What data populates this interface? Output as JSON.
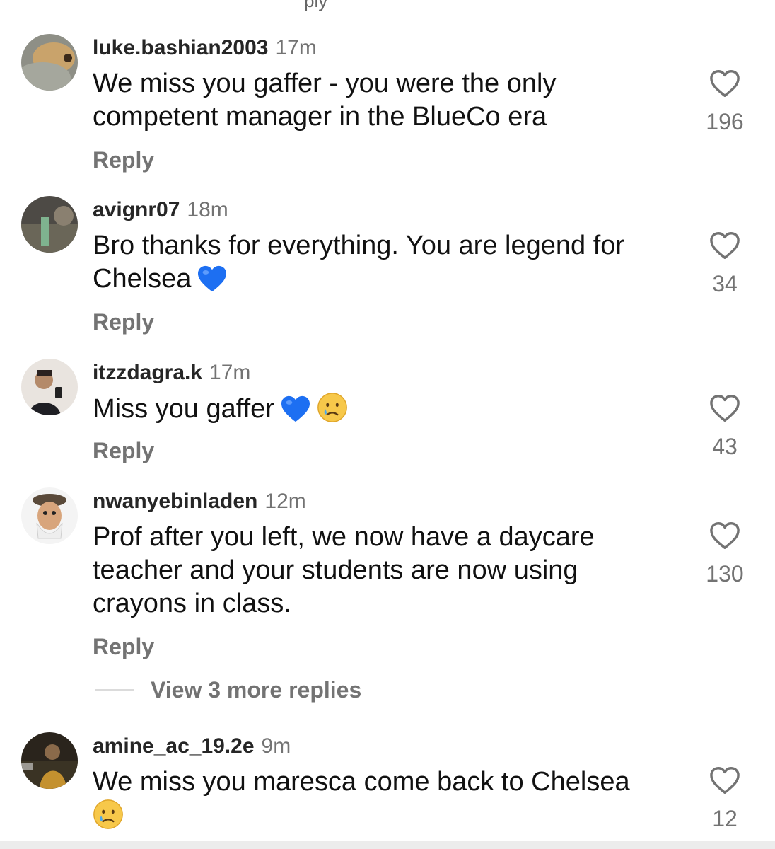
{
  "top_cut_label": "ply",
  "comments": [
    {
      "username": "luke.bashian2003",
      "time": "17m",
      "text": "We miss you gaffer - you were the only competent manager in the BlueCo era",
      "reply": "Reply",
      "likes": "196"
    },
    {
      "username": "avignr07",
      "time": "18m",
      "text": "Bro thanks for everything. You are legend for Chelsea",
      "reply": "Reply",
      "likes": "34"
    },
    {
      "username": "itzzdagra.k",
      "time": "17m",
      "text": "Miss you gaffer",
      "reply": "Reply",
      "likes": "43"
    },
    {
      "username": "nwanyebinladen",
      "time": "12m",
      "text": "Prof after you left, we now have a daycare teacher and your students are now using crayons in class.",
      "reply": "Reply",
      "likes": "130"
    },
    {
      "username": "amine_ac_19.2e",
      "time": "9m",
      "text": "We miss you maresca come back to Chelsea",
      "reply": "Reply",
      "likes": "12"
    }
  ],
  "view_more": "View 3 more replies",
  "colors": {
    "secondary_text": "#737373",
    "blue_heart": "#1d6ff2",
    "divider": "#dbdbdb"
  },
  "icons": [
    "heart-outline-icon",
    "blue-heart-emoji",
    "crying-face-emoji"
  ]
}
